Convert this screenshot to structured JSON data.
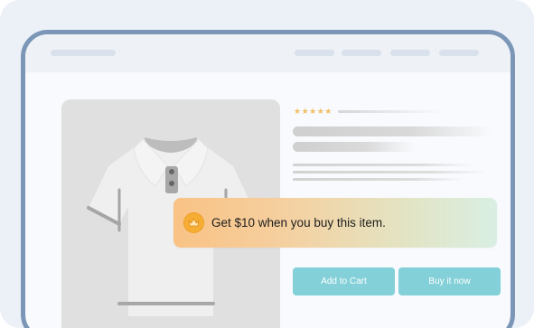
{
  "rating": {
    "stars": "★★★★★"
  },
  "actions": {
    "add_to_cart_label": "Add to Cart",
    "buy_now_label": "Buy it now"
  },
  "promo": {
    "text": "Get $10 when you buy this item.",
    "icon": "crown-icon"
  },
  "colors": {
    "frame": "#7b96b7",
    "button": "#83d0d8",
    "star": "#f0bf63",
    "promo_start": "#f9c285",
    "promo_end": "#d9efe3"
  }
}
